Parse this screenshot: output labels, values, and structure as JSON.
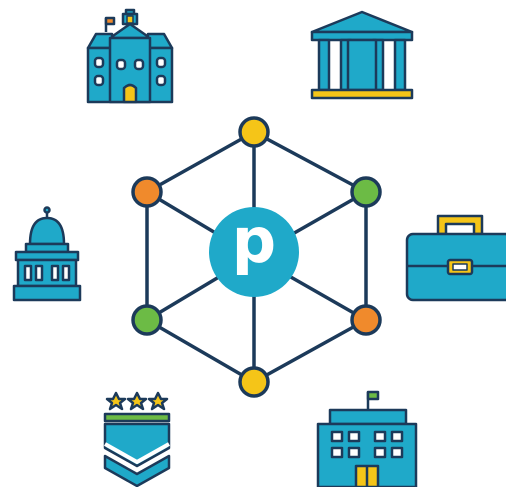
{
  "hub": {
    "letter": "p",
    "color": "#1fa9c9"
  },
  "palette": {
    "outline": "#1c3a5a",
    "teal": "#1fa9c9",
    "yellow": "#f5c518",
    "orange": "#f08a2c",
    "green": "#6cbb45",
    "white": "#ffffff"
  },
  "network_nodes": [
    {
      "name": "top",
      "color": "yellow"
    },
    {
      "name": "upper-right",
      "color": "green"
    },
    {
      "name": "lower-right",
      "color": "orange"
    },
    {
      "name": "bottom",
      "color": "yellow"
    },
    {
      "name": "lower-left",
      "color": "green"
    },
    {
      "name": "upper-left",
      "color": "orange"
    }
  ],
  "icons": [
    {
      "name": "school-building-icon"
    },
    {
      "name": "courthouse-icon"
    },
    {
      "name": "capitol-building-icon"
    },
    {
      "name": "briefcase-icon"
    },
    {
      "name": "military-rank-insignia-icon"
    },
    {
      "name": "office-building-icon"
    }
  ]
}
